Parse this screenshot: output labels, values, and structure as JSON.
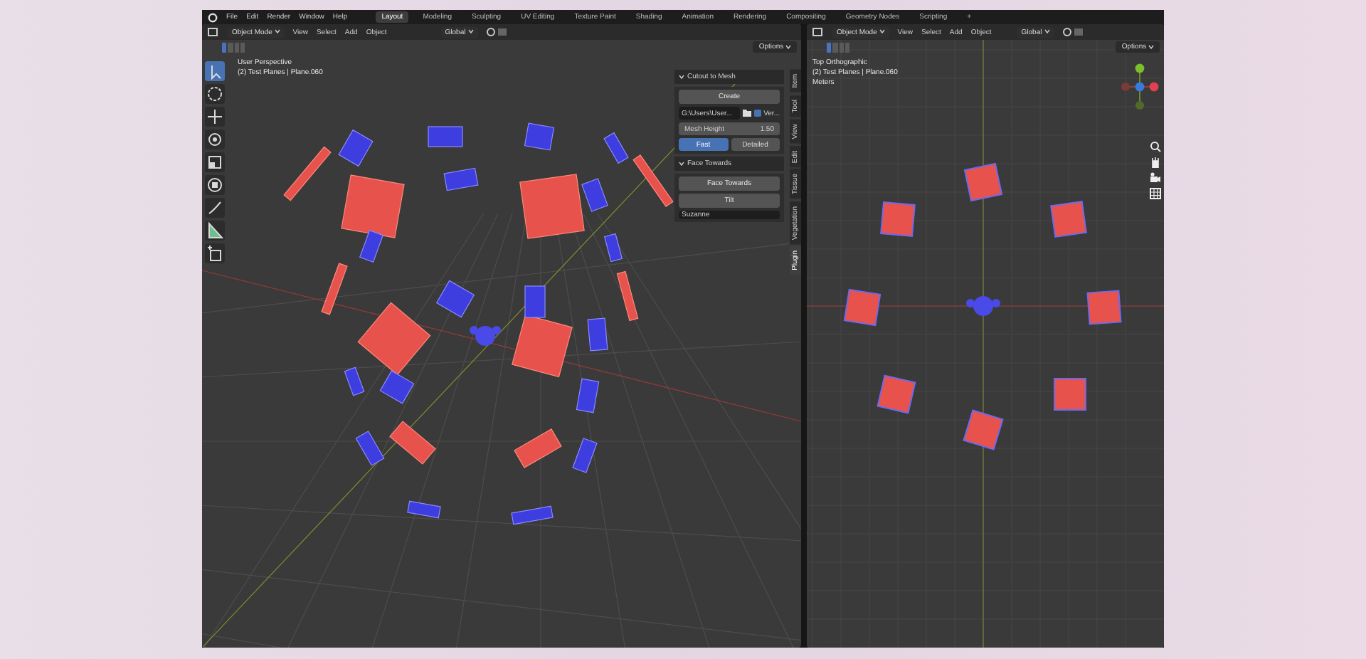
{
  "menu": [
    "File",
    "Edit",
    "Render",
    "Window",
    "Help"
  ],
  "workspaces": [
    {
      "label": "Layout",
      "selected": true
    },
    {
      "label": "Modeling",
      "selected": false
    },
    {
      "label": "Sculpting",
      "selected": false
    },
    {
      "label": "UV Editing",
      "selected": false
    },
    {
      "label": "Texture Paint",
      "selected": false
    },
    {
      "label": "Shading",
      "selected": false
    },
    {
      "label": "Animation",
      "selected": false
    },
    {
      "label": "Rendering",
      "selected": false
    },
    {
      "label": "Compositing",
      "selected": false
    },
    {
      "label": "Geometry Nodes",
      "selected": false
    },
    {
      "label": "Scripting",
      "selected": false
    },
    {
      "label": "+",
      "selected": false
    }
  ],
  "left_viewport": {
    "mode": "Object Mode",
    "menus": [
      "View",
      "Select",
      "Add",
      "Object"
    ],
    "orientation": "Global",
    "options": "Options",
    "overlay": [
      "User Perspective",
      "(2) Test Planes | Plane.060"
    ],
    "tools": [
      {
        "kind": "select",
        "selected": true
      },
      {
        "kind": "cursor",
        "selected": false
      },
      {
        "kind": "move",
        "selected": false
      },
      {
        "kind": "rotate",
        "selected": false
      },
      {
        "kind": "scale",
        "selected": false
      },
      {
        "kind": "transform",
        "selected": false
      },
      {
        "kind": "annotate",
        "selected": false
      },
      {
        "kind": "measure",
        "selected": false
      },
      {
        "kind": "add-cube",
        "selected": false
      }
    ],
    "sidebar": {
      "panels": [
        {
          "title": "Cutout to Mesh",
          "expanded": true,
          "button": "Create",
          "path": "G:\\Users\\User...",
          "checkbox": {
            "label": "Ver...",
            "checked": true
          },
          "field": {
            "label": "Mesh Height",
            "value": "1.50"
          },
          "segments": [
            {
              "label": "Fast",
              "selected": true
            },
            {
              "label": "Detailed",
              "selected": false
            }
          ]
        },
        {
          "title": "Face Towards",
          "expanded": true,
          "buttons": [
            "Face Towards",
            "Tilt"
          ],
          "object": "Suzanne"
        }
      ],
      "tabs": [
        {
          "label": "Item",
          "selected": false
        },
        {
          "label": "Tool",
          "selected": false
        },
        {
          "label": "View",
          "selected": false
        },
        {
          "label": "Edit",
          "selected": false
        },
        {
          "label": "Tissue",
          "selected": false
        },
        {
          "label": "Vegetation",
          "selected": false
        },
        {
          "label": "Plugin",
          "selected": true
        }
      ]
    }
  },
  "right_viewport": {
    "mode": "Object Mode",
    "menus": [
      "View",
      "Select",
      "Add",
      "Object"
    ],
    "orientation": "Global",
    "options": "Options",
    "overlay": [
      "Top Orthographic",
      "(2) Test Planes | Plane.060",
      "Meters"
    ]
  }
}
